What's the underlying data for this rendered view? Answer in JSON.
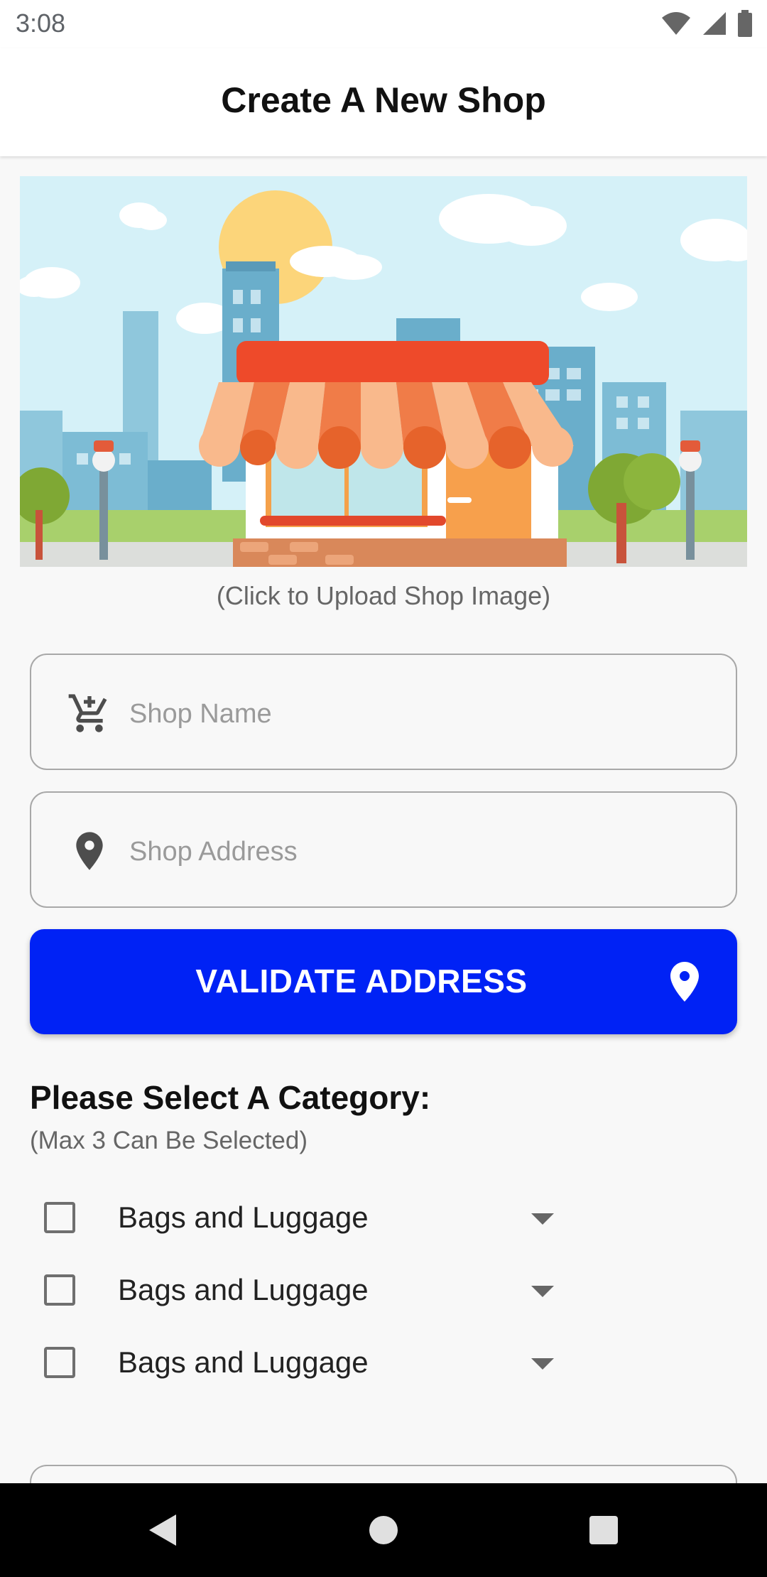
{
  "status_bar": {
    "time": "3:08"
  },
  "app_bar": {
    "title": "Create A New Shop"
  },
  "shop_image": {
    "caption": "(Click to Upload Shop Image)"
  },
  "form": {
    "shop_name": {
      "placeholder": "Shop Name",
      "value": "",
      "icon": "cart-icon"
    },
    "shop_address": {
      "placeholder": "Shop Address",
      "value": "",
      "icon": "location-pin-icon"
    }
  },
  "validate_button": {
    "label": "VALIDATE ADDRESS",
    "icon": "location-pin-icon"
  },
  "categories": {
    "heading": "Please Select A Category:",
    "note": "(Max 3 Can Be Selected)",
    "items": [
      {
        "label": "Bags and Luggage",
        "checked": false
      },
      {
        "label": "Bags and Luggage",
        "checked": false
      },
      {
        "label": "Bags and Luggage",
        "checked": false
      }
    ]
  },
  "colors": {
    "primary_button": "#0022f5",
    "background": "#f8f8f8",
    "nav_bar": "#000000"
  }
}
